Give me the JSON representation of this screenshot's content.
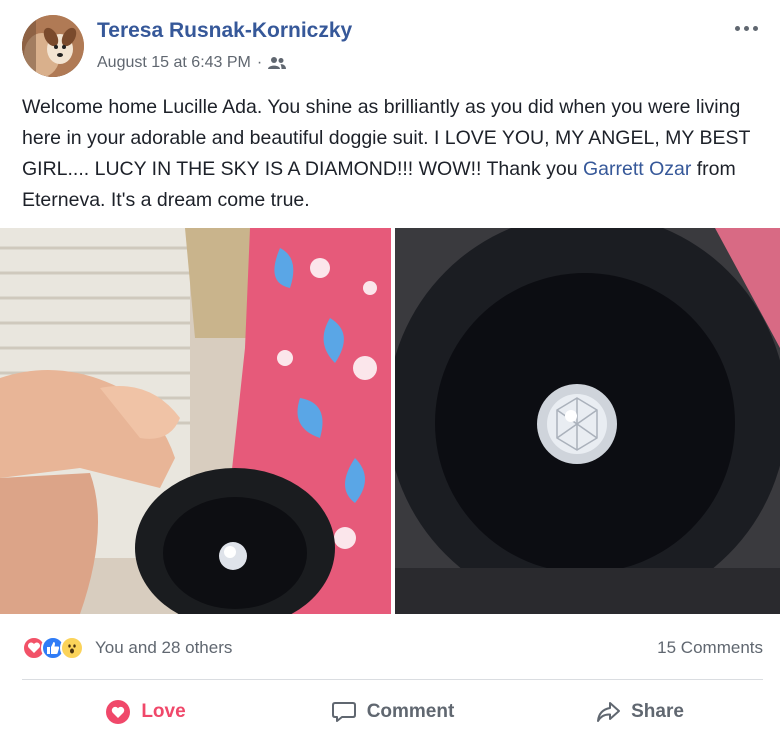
{
  "post": {
    "author": "Teresa Rusnak-Korniczky",
    "timestamp": "August 15 at 6:43 PM",
    "separator": "·",
    "audience_icon": "friends-icon",
    "text_before_mention": "Welcome home Lucille Ada. You shine as brilliantly as you did when you were living here in your adorable and beautiful doggie suit. I LOVE YOU, MY ANGEL, MY BEST GIRL.... LUCY IN THE SKY IS A DIAMOND!!! WOW!! Thank you ",
    "mention": "Garrett Ozar",
    "text_after_mention": " from Eterneva. It's a dream come true."
  },
  "photos": [
    {
      "icon": "photo-hand-holding-diamond-case"
    },
    {
      "icon": "photo-diamond-closeup"
    }
  ],
  "reactions": {
    "icons": [
      "love-reaction-icon",
      "like-reaction-icon",
      "wow-reaction-icon"
    ],
    "summary": "You and 28 others",
    "comments": "15 Comments"
  },
  "actions": {
    "love": "Love",
    "comment": "Comment",
    "share": "Share"
  },
  "colors": {
    "link": "#365899",
    "love": "#f0486a",
    "like": "#2f7cf6",
    "wow": "#fbd35a",
    "secondary_text": "#606770"
  }
}
